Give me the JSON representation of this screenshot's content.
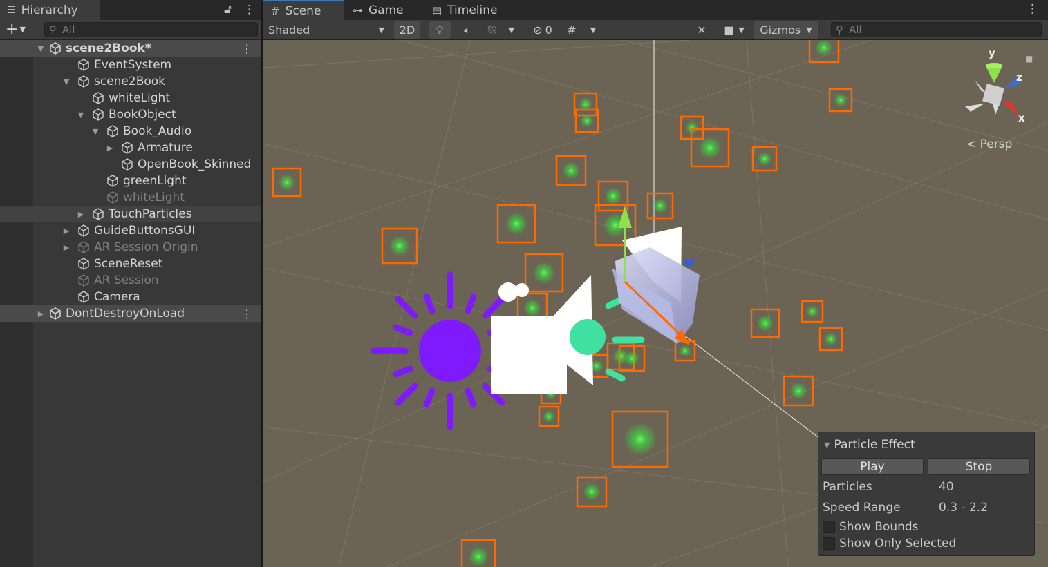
{
  "hierarchy": {
    "tab_label": "Hierarchy",
    "add_label": "+",
    "search_placeholder": "All",
    "items": [
      {
        "label": "scene2Book*",
        "depth": 0,
        "kind": "scene",
        "expanded": true
      },
      {
        "label": "EventSystem",
        "depth": 1,
        "kind": "object"
      },
      {
        "label": "scene2Book",
        "depth": 1,
        "kind": "object",
        "expanded": true
      },
      {
        "label": "whiteLight",
        "depth": 2,
        "kind": "object"
      },
      {
        "label": "BookObject",
        "depth": 2,
        "kind": "object",
        "expanded": true
      },
      {
        "label": "Book_Audio",
        "depth": 3,
        "kind": "object",
        "expanded": true
      },
      {
        "label": "Armature",
        "depth": 4,
        "kind": "object",
        "expanded": false
      },
      {
        "label": "OpenBook_Skinned",
        "depth": 4,
        "kind": "object"
      },
      {
        "label": "greenLight",
        "depth": 3,
        "kind": "object"
      },
      {
        "label": "whiteLight",
        "depth": 3,
        "kind": "object",
        "inactive": true
      },
      {
        "label": "TouchParticles",
        "depth": 2,
        "kind": "object",
        "expanded": false,
        "highlighted": true
      },
      {
        "label": "GuideButtonsGUI",
        "depth": 1,
        "kind": "object",
        "expanded": false
      },
      {
        "label": "AR Session Origin",
        "depth": 1,
        "kind": "object",
        "expanded": false,
        "inactive": true
      },
      {
        "label": "SceneReset",
        "depth": 1,
        "kind": "object"
      },
      {
        "label": "AR Session",
        "depth": 1,
        "kind": "object",
        "inactive": true
      },
      {
        "label": "Camera",
        "depth": 1,
        "kind": "object"
      },
      {
        "label": "DontDestroyOnLoad",
        "depth": 0,
        "kind": "scene",
        "expanded": false
      }
    ]
  },
  "scene_view": {
    "tabs": [
      {
        "label": "Scene",
        "icon": "hash-icon",
        "active": true
      },
      {
        "label": "Game",
        "icon": "gamepad-icon",
        "active": false
      },
      {
        "label": "Timeline",
        "icon": "film-icon",
        "active": false
      }
    ],
    "toolbar": {
      "draw_mode": "Shaded",
      "two_d_label": "2D",
      "hidden_count": "0",
      "gizmos_label": "Gizmos",
      "search_placeholder": "All"
    },
    "orientation": {
      "projection_label": "Persp",
      "axis_x": "x",
      "axis_y": "y",
      "axis_z": "z"
    },
    "colors": {
      "selection_outline": "#ff6a00",
      "particle": "#3fd03f",
      "light_gizmo": "#7f1aff",
      "grid_bg": "#6b6353"
    }
  },
  "particle_effect": {
    "title": "Particle Effect",
    "play_label": "Play",
    "stop_label": "Stop",
    "particles_label": "Particles",
    "particles_value": "40",
    "speed_label": "Speed Range",
    "speed_value": "0.3 - 2.2",
    "show_bounds_label": "Show Bounds",
    "show_bounds_checked": false,
    "show_only_selected_label": "Show Only Selected",
    "show_only_selected_checked": false
  }
}
